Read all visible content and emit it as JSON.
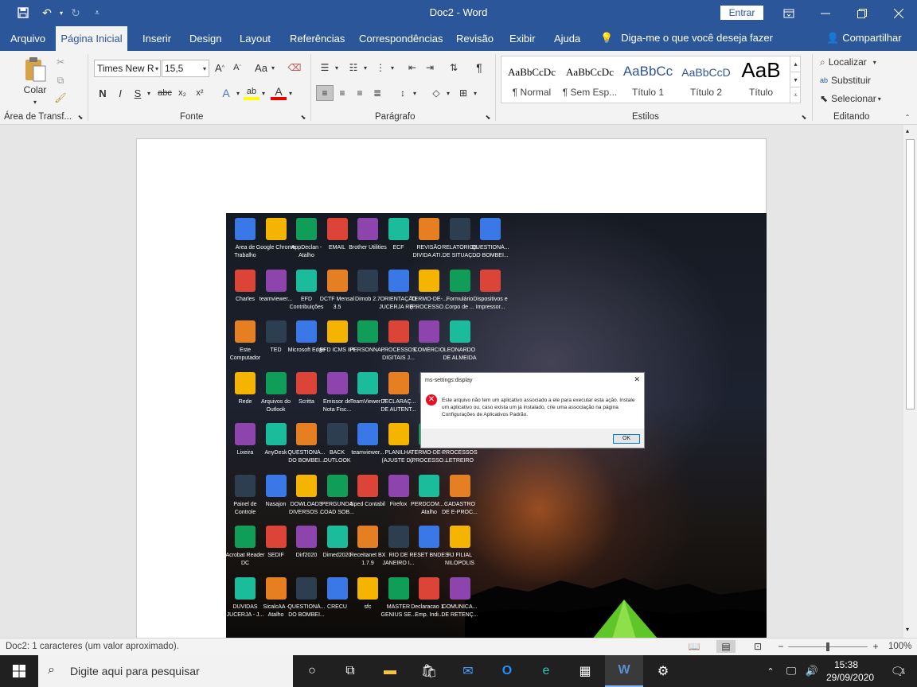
{
  "window": {
    "title": "Doc2 - Word",
    "signin": "Entrar"
  },
  "tabs": [
    "Arquivo",
    "Página Inicial",
    "Inserir",
    "Design",
    "Layout",
    "Referências",
    "Correspondências",
    "Revisão",
    "Exibir",
    "Ajuda"
  ],
  "tellme": "Diga-me o que você deseja fazer",
  "share": "Compartilhar",
  "ribbon": {
    "clipboard": {
      "paste": "Colar",
      "label": "Área de Transf..."
    },
    "font": {
      "name": "Times New R",
      "size": "15,5",
      "label": "Fonte",
      "bold": "N",
      "italic": "I",
      "underline": "S",
      "strike": "abc",
      "sub": "x₂",
      "sup": "x²",
      "case": "Aa"
    },
    "paragraph": {
      "label": "Parágrafo"
    },
    "styles": {
      "label": "Estilos",
      "items": [
        {
          "preview": "AaBbCcDc",
          "name": "¶ Normal"
        },
        {
          "preview": "AaBbCcDc",
          "name": "¶ Sem Esp..."
        },
        {
          "preview": "AaBbCc",
          "name": "Título 1"
        },
        {
          "preview": "AaBbCcD",
          "name": "Título 2"
        },
        {
          "preview": "AaB",
          "name": "Título"
        }
      ]
    },
    "editing": {
      "label": "Editando",
      "find": "Localizar",
      "replace": "Substituir",
      "select": "Selecionar"
    }
  },
  "desktop_icons": [
    [
      "Área de Trabalho",
      "Google Chrome",
      "AppDeclan - Atalho",
      "EMAIL",
      "Brother Utilities",
      "ECF",
      "REVISÃO DIVIDA ATI...",
      "RELATÓRIOS DE SITUAÇ...",
      "QUESTIONÁ... DO BOMBEI..."
    ],
    [
      "Charles",
      "teamviewer...",
      "EFD Contribuições",
      "DCTF Mensal 3.5",
      "Dimob 2.7",
      "ORIENTAÇÃO JUCERJA RE...",
      "TERMO-DE-... (PROCESSO...",
      "Formulário Corpo de ...",
      "Dispositivos e Impressor..."
    ],
    [
      "Este Computador",
      "TED",
      "Microsoft Edge",
      "EFD ICMS IPI",
      "PERSONNA...",
      "PROCESSOS DIGITAIS J...",
      "COMÉRCIO",
      "LEONARDO DE ALMEIDA"
    ],
    [
      "Rede",
      "Arquivos do Outlook",
      "Scritta",
      "Emissor de Nota Fisc...",
      "TeamViewer 7",
      "DECLARAÇ... DE AUTENT...",
      "ALT"
    ],
    [
      "Lixeira",
      "AnyDesk",
      "QUESTIONÁ... DO BOMBEI...",
      "BACK OUTLOOK",
      "teamviewer...",
      "PLANILHA (AJUSTE D...",
      "TERMO-DE-... (PROCESSO...",
      "PROCESSOS LETREIRO"
    ],
    [
      "Painel de Controle",
      "Nasajon",
      "DOWLOADS DIVERSOS ...",
      "PERGUNDA COAD SOB...",
      "Sped Contabil",
      "Firefox",
      "PERDCOM... - Atalho",
      "CADASTRO DE E-PROC..."
    ],
    [
      "Acrobat Reader DC",
      "SEDIF",
      "Dirf2020",
      "Dimed2020",
      "Receitanet BX 1.7.9",
      "RIO DE JANEIRO I...",
      "RESET BNDES",
      "RJ FILIAL NILOPOLIS"
    ],
    [
      "DUVIDAS JUCERJA - J...",
      "SicalcAA - Atalho",
      "QUESTIONÁ... DO BOMBEI...",
      "CRECU",
      "sfc",
      "MASTER GENIUS SE...",
      "Declaracao 1 - Emp. Indi...",
      "COMUNICA... DE RETENÇ..."
    ]
  ],
  "dialog": {
    "title": "ms-settings:display",
    "message": "Este arquivo não tem um aplicativo associado a ele para executar esta ação. Instale um aplicativo ou, caso exista um já instalado, crie uma associação na página Configurações de Aplicativos Padrão.",
    "ok": "OK"
  },
  "status": {
    "text": "Doc2: 1 caracteres (um valor aproximado).",
    "zoom": "100%"
  },
  "taskbar": {
    "search_placeholder": "Digite aqui para pesquisar",
    "time": "15:38",
    "date": "29/09/2020",
    "notifications": "1"
  },
  "colors": {
    "word_blue": "#2b579a",
    "taskbar": "#202020"
  }
}
